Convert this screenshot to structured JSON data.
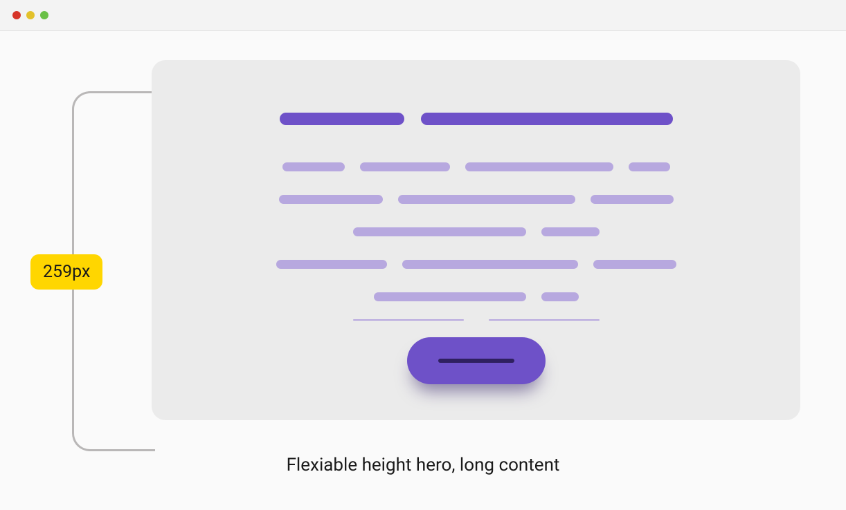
{
  "window": {
    "traffic": {
      "red": "close",
      "yellow": "minimize",
      "green": "zoom"
    }
  },
  "measurement": {
    "height_label": "259px"
  },
  "caption": "Flexiable height hero, long content",
  "colors": {
    "accent_primary": "#6e51c8",
    "accent_light": "#b7a8df",
    "badge_bg": "#ffd600",
    "card_bg": "#ebebeb",
    "bracket": "#b9b7b7"
  },
  "hero": {
    "type": "skeleton-placeholder",
    "heading_bars": 2,
    "body_rows": 5,
    "has_cta": true
  }
}
